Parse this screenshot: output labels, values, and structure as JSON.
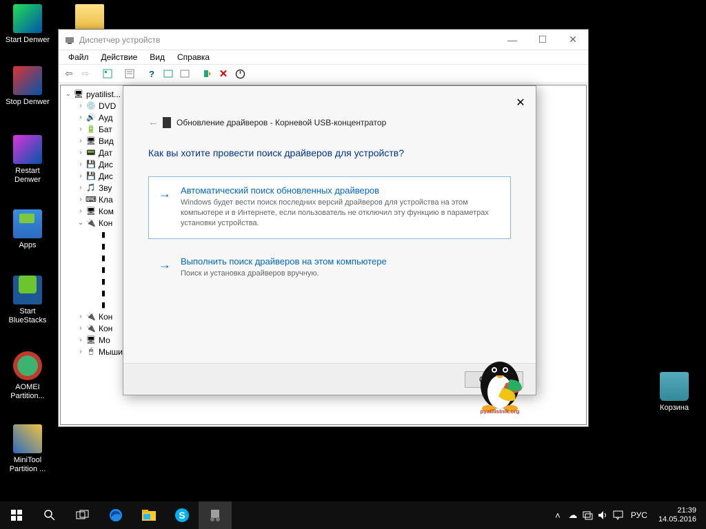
{
  "desktop": {
    "icons": [
      {
        "label": "Start Denwer"
      },
      {
        "label": "Stop Denwer"
      },
      {
        "label": "Restart Denwer"
      },
      {
        "label": "Apps"
      },
      {
        "label": "Start BlueStacks"
      },
      {
        "label": "AOMEI Partition..."
      },
      {
        "label": "MiniTool Partition ..."
      },
      {
        "label": "Корзина"
      }
    ]
  },
  "deviceManager": {
    "title": "Диспетчер устройств",
    "menu": {
      "file": "Файл",
      "action": "Действие",
      "view": "Вид",
      "help": "Справка"
    },
    "root": "pyatilist...",
    "categories": [
      {
        "label": "DVD",
        "expand": ">"
      },
      {
        "label": "Ауд",
        "expand": ">"
      },
      {
        "label": "Бат",
        "expand": ">"
      },
      {
        "label": "Вид",
        "expand": ">"
      },
      {
        "label": "Дат",
        "expand": ">"
      },
      {
        "label": "Дис",
        "expand": ">"
      },
      {
        "label": "Дис",
        "expand": ">"
      },
      {
        "label": "Зву",
        "expand": ">"
      },
      {
        "label": "Кла",
        "expand": ">"
      },
      {
        "label": "Ком",
        "expand": ">"
      },
      {
        "label": "Кон",
        "expand": "v"
      }
    ],
    "usbChildren": [
      "",
      "",
      "",
      "",
      "",
      "",
      ""
    ],
    "tail": [
      {
        "label": "Кон",
        "expand": ">"
      },
      {
        "label": "Кон",
        "expand": ">"
      },
      {
        "label": "Мо",
        "expand": ">"
      },
      {
        "label": "Мыши и иные указывающие устройства",
        "expand": ">"
      }
    ]
  },
  "driverDialog": {
    "heading": "Обновление драйверов - Корневой USB-концентратор",
    "question": "Как вы хотите провести поиск драйверов для устройств?",
    "option1": {
      "title": "Автоматический поиск обновленных драйверов",
      "desc": "Windows будет вести поиск последних версий драйверов для устройства на этом компьютере и в Интернете, если пользователь не отключил эту функцию в параметрах установки устройства."
    },
    "option2": {
      "title": "Выполнить поиск драйверов на этом компьютере",
      "desc": "Поиск и установка драйверов вручную."
    },
    "cancel": "Отмена"
  },
  "watermark": "pyatilistnik.org",
  "taskbar": {
    "lang": "РУС",
    "time": "21:39",
    "date": "14.05.2016"
  }
}
